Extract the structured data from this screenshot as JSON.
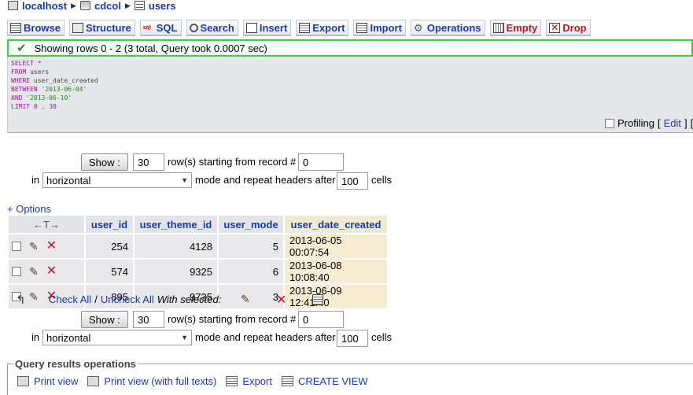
{
  "breadcrumb": {
    "server": "localhost",
    "database": "cdcol",
    "table": "users"
  },
  "tabs": [
    {
      "label": "Browse",
      "icon": "browse-icon"
    },
    {
      "label": "Structure",
      "icon": "structure-icon"
    },
    {
      "label": "SQL",
      "icon": "sql-icon"
    },
    {
      "label": "Search",
      "icon": "search-icon"
    },
    {
      "label": "Insert",
      "icon": "insert-icon"
    },
    {
      "label": "Export",
      "icon": "export-icon"
    },
    {
      "label": "Import",
      "icon": "import-icon"
    },
    {
      "label": "Operations",
      "icon": "operations-icon"
    },
    {
      "label": "Empty",
      "icon": "empty-icon"
    },
    {
      "label": "Drop",
      "icon": "drop-icon"
    }
  ],
  "message": "Showing rows 0 - 2 (3 total, Query took 0.0007 sec)",
  "sql": {
    "kw_select": "SELECT",
    "star": "*",
    "kw_from": "FROM",
    "table": "users",
    "kw_where": "WHERE",
    "column": "user_date_created",
    "kw_between": "BETWEEN",
    "date_from": "'2013-06-04'",
    "kw_and": "AND",
    "date_to": "'2013-06-10'",
    "kw_limit": "LIMIT",
    "limit_values": "0 , 30"
  },
  "profiling": {
    "label": "Profiling",
    "edit": "Edit",
    "open_bracket": "[",
    "close_bracket": "]",
    "trail": "["
  },
  "nav": {
    "show_button": "Show :",
    "rows_value": "30",
    "rows_label": "row(s) starting from record #",
    "start_value": "0",
    "in_label": "in",
    "mode_value": "horizontal",
    "mode_label": "mode and repeat headers after",
    "repeat_value": "100",
    "cells_label": "cells"
  },
  "options_link": "+ Options",
  "columns": [
    "user_id",
    "user_theme_id",
    "user_mode",
    "user_date_created"
  ],
  "rows": [
    {
      "user_id": "254",
      "user_theme_id": "4128",
      "user_mode": "5",
      "user_date_created": "2013-06-05 00:07:54"
    },
    {
      "user_id": "574",
      "user_theme_id": "9325",
      "user_mode": "6",
      "user_date_created": "2013-06-08 10:08:40"
    },
    {
      "user_id": "895",
      "user_theme_id": "9735",
      "user_mode": "3",
      "user_date_created": "2013-06-09 12:41:40"
    }
  ],
  "bulk": {
    "check_all": "Check All",
    "separator": "/",
    "uncheck_all": "Uncheck All",
    "with_selected": "With selected:"
  },
  "query_ops": {
    "legend": "Query results operations",
    "print_view": "Print view",
    "print_view_full": "Print view (with full texts)",
    "export": "Export",
    "create_view": "CREATE VIEW"
  }
}
